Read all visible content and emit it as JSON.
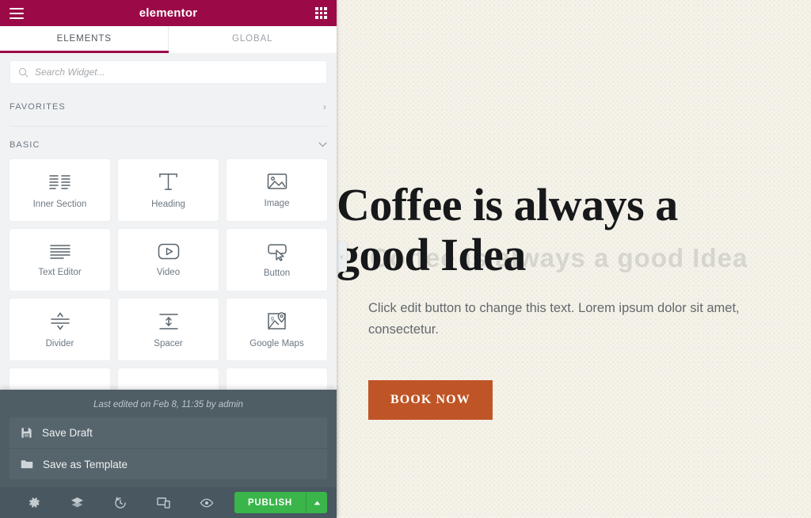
{
  "panel": {
    "header": {
      "brand": "elementor",
      "menu_icon": "hamburger-menu-icon",
      "apps_icon": "grid-apps-icon"
    },
    "tabs": [
      {
        "label": "ELEMENTS",
        "active": true
      },
      {
        "label": "GLOBAL",
        "active": false
      }
    ],
    "search": {
      "placeholder": "Search Widget...",
      "value": "",
      "icon": "search-icon"
    },
    "categories": [
      {
        "label": "FAVORITES",
        "expanded": false,
        "chevron": "›"
      },
      {
        "label": "BASIC",
        "expanded": true,
        "chevron": "⌵"
      }
    ],
    "widgets": [
      {
        "label": "Inner Section",
        "icon": "inner-section-icon"
      },
      {
        "label": "Heading",
        "icon": "heading-icon"
      },
      {
        "label": "Image",
        "icon": "image-icon"
      },
      {
        "label": "Text Editor",
        "icon": "text-editor-icon"
      },
      {
        "label": "Video",
        "icon": "video-icon"
      },
      {
        "label": "Button",
        "icon": "button-icon"
      },
      {
        "label": "Divider",
        "icon": "divider-icon"
      },
      {
        "label": "Spacer",
        "icon": "spacer-icon"
      },
      {
        "label": "Google Maps",
        "icon": "google-maps-icon"
      }
    ]
  },
  "save_panel": {
    "last_edited": "Last edited on Feb 8, 11:35 by admin",
    "items": [
      {
        "label": "Save Draft",
        "icon": "floppy-disk-icon"
      },
      {
        "label": "Save as Template",
        "icon": "folder-icon"
      }
    ]
  },
  "bottom_bar": {
    "icons": [
      "settings-gear-icon",
      "navigator-layers-icon",
      "history-revisions-icon",
      "responsive-mode-icon",
      "preview-eye-icon"
    ],
    "publish_label": "PUBLISH",
    "publish_caret": "▲",
    "publish_color": "#39b54a"
  },
  "preview": {
    "collapse_handle": "‹",
    "hero": {
      "title": "Coffee is always a good Idea",
      "watermark": "Coffee is always a good Idea",
      "subtitle": "Click edit button to change this text. Lorem ipsum dolor sit amet, consectetur.",
      "button_label": "BOOK NOW",
      "button_color": "#bf5526",
      "background_color": "#f4f2e9"
    }
  },
  "theme": {
    "brand_color": "#9b0a46",
    "panel_bg": "#f1f2f3",
    "save_panel_bg": "#4f5e65",
    "bottom_bar_bg": "#495760"
  }
}
